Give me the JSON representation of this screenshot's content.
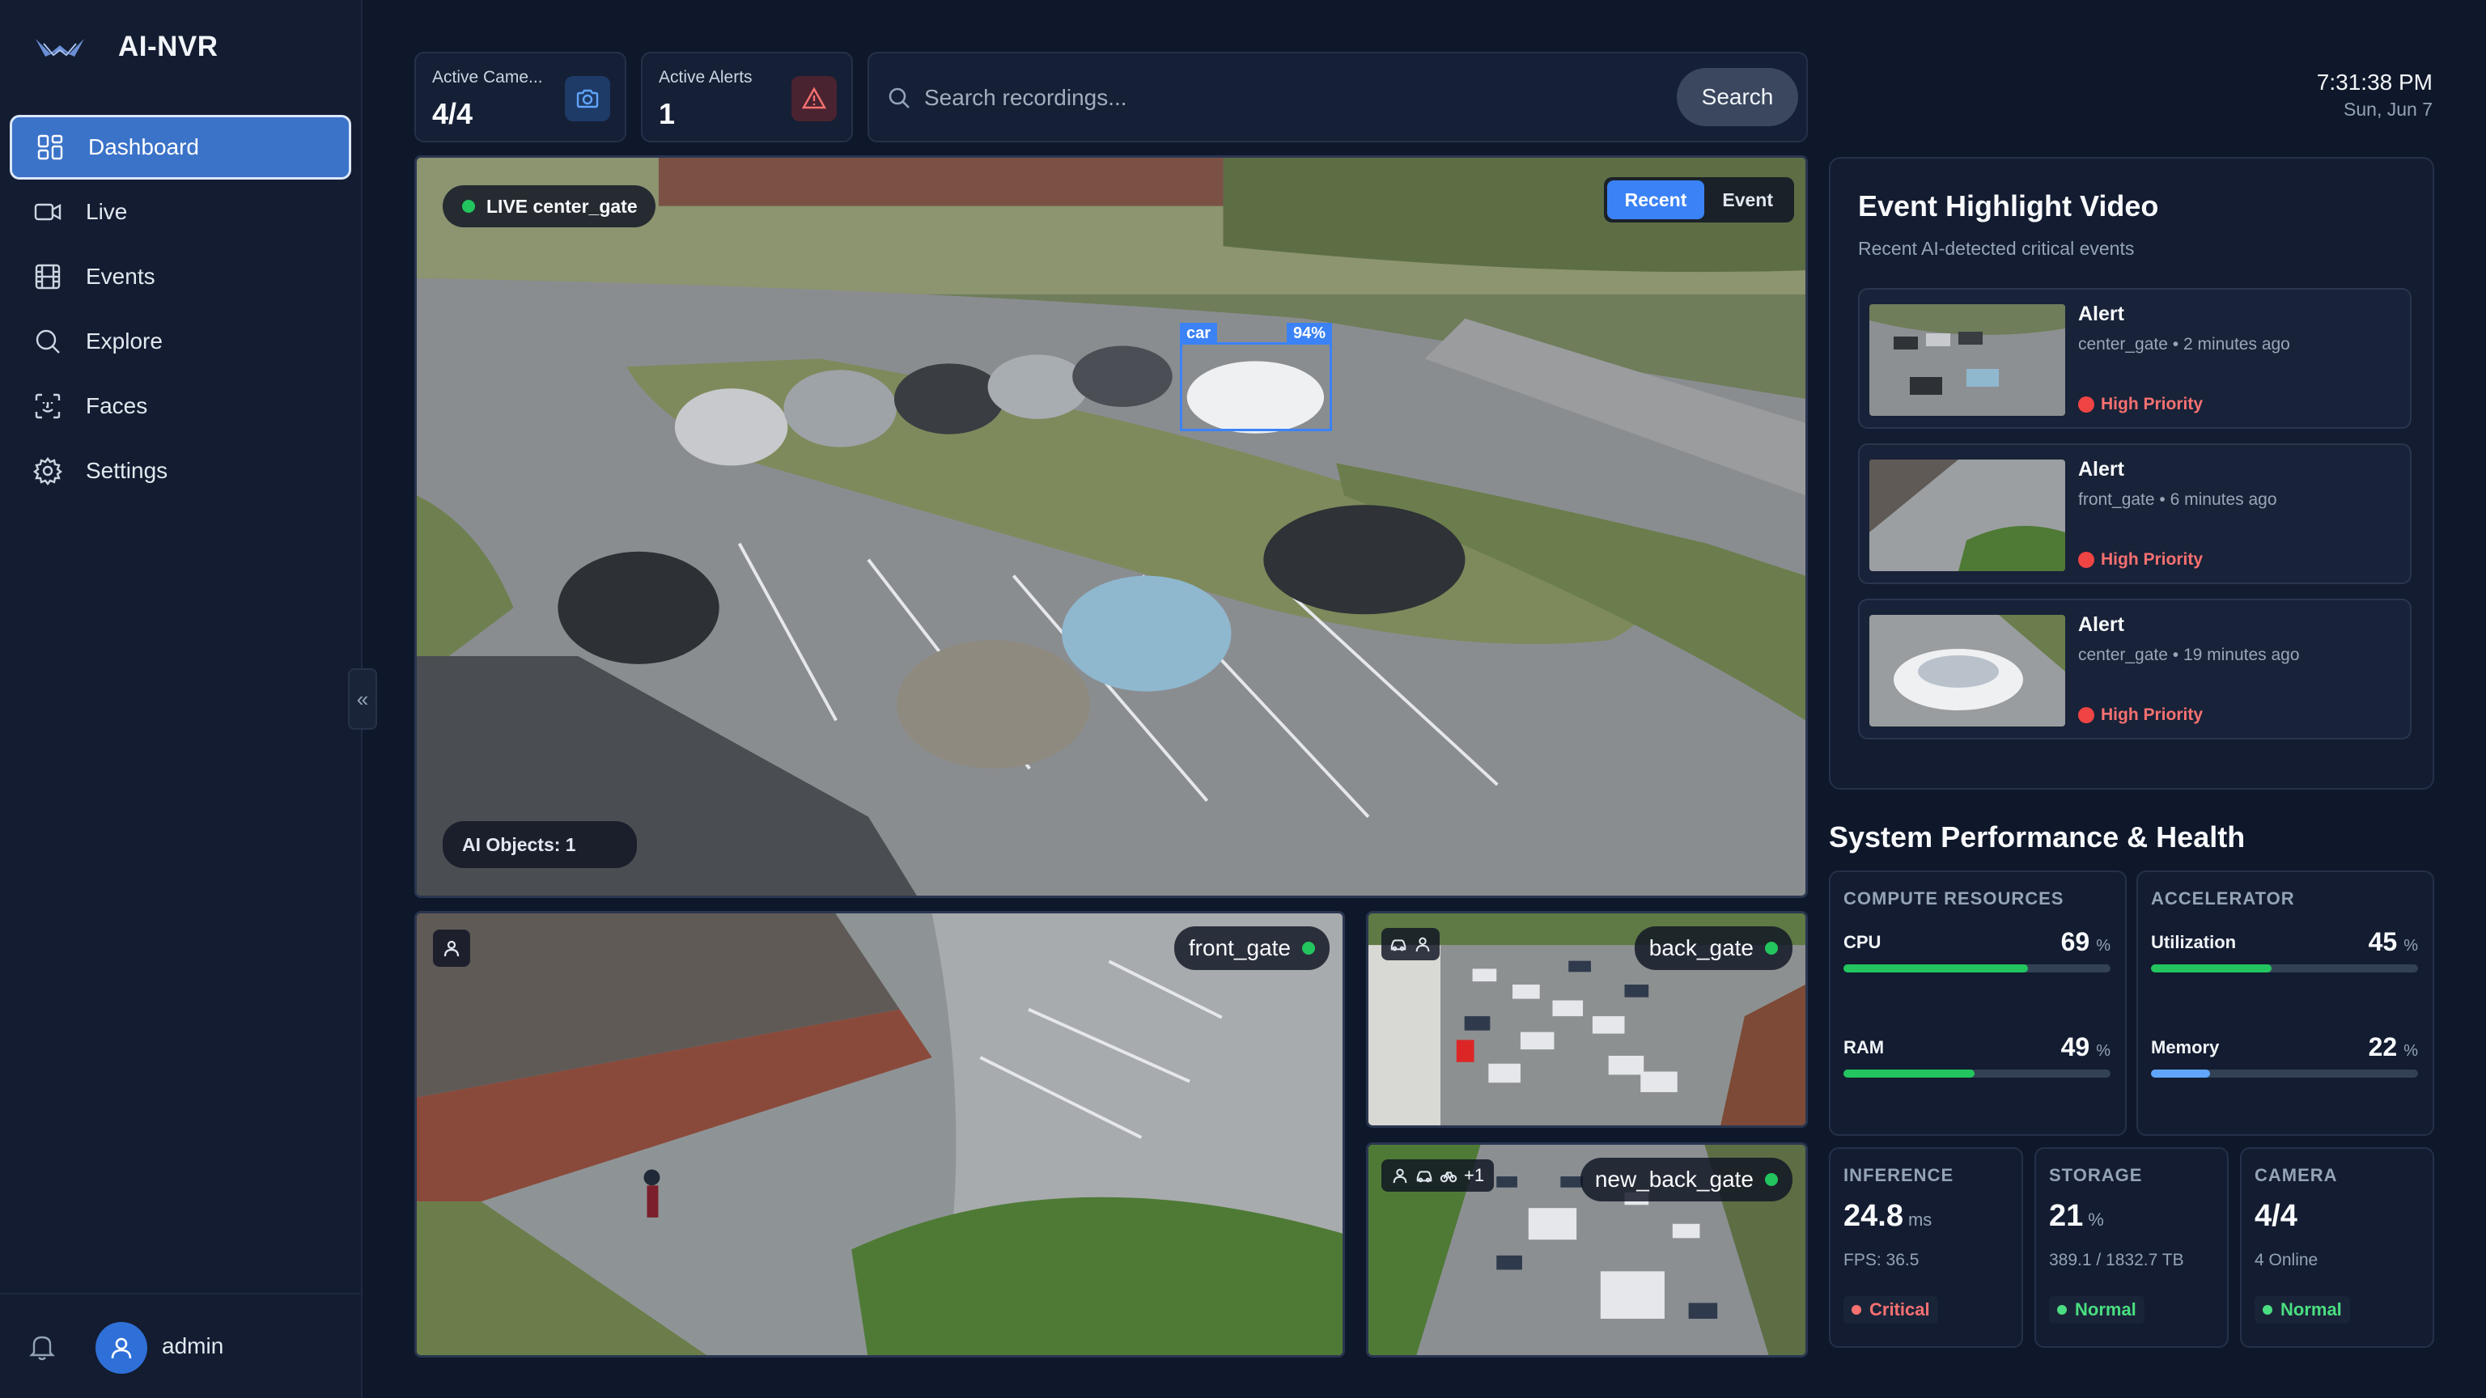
{
  "app": {
    "name": "AI-NVR"
  },
  "sidebar": {
    "items": [
      {
        "label": "Dashboard",
        "icon": "dashboard-icon",
        "active": true
      },
      {
        "label": "Live",
        "icon": "video-icon"
      },
      {
        "label": "Events",
        "icon": "film-icon"
      },
      {
        "label": "Explore",
        "icon": "search-icon"
      },
      {
        "label": "Faces",
        "icon": "face-scan-icon"
      },
      {
        "label": "Settings",
        "icon": "gear-icon"
      }
    ],
    "collapse_glyph": "«",
    "user": "admin"
  },
  "topbar": {
    "active_cameras": {
      "label": "Active Came...",
      "value": "4/4"
    },
    "active_alerts": {
      "label": "Active Alerts",
      "value": "1"
    },
    "search": {
      "placeholder": "Search recordings...",
      "button": "Search"
    },
    "clock": {
      "time": "7:31:38 PM",
      "date": "Sun, Jun 7"
    }
  },
  "main_feed": {
    "live_label": "LIVE center_gate",
    "toggles": [
      "Recent",
      "Event"
    ],
    "active_toggle": "Recent",
    "detection": {
      "label": "car",
      "confidence": "94%"
    },
    "objects": "AI Objects: 1"
  },
  "feeds": [
    {
      "name": "front_gate",
      "extra": ""
    },
    {
      "name": "back_gate",
      "extra": ""
    },
    {
      "name": "new_back_gate",
      "extra": "+1"
    }
  ],
  "event_panel": {
    "title": "Event Highlight Video",
    "subtitle": "Recent AI-detected critical events",
    "events": [
      {
        "type": "Alert",
        "meta": "center_gate • 2 minutes ago",
        "priority": "High Priority"
      },
      {
        "type": "Alert",
        "meta": "front_gate • 6 minutes ago",
        "priority": "High Priority"
      },
      {
        "type": "Alert",
        "meta": "center_gate • 19 minutes ago",
        "priority": "High Priority"
      }
    ]
  },
  "performance": {
    "title": "System Performance & Health",
    "compute": {
      "heading": "COMPUTE RESOURCES",
      "cpu": {
        "label": "CPU",
        "value": "69",
        "unit": "%",
        "level": 0.69,
        "color": "#22c55e"
      },
      "ram": {
        "label": "RAM",
        "value": "49",
        "unit": "%",
        "level": 0.49,
        "color": "#22c55e"
      }
    },
    "accelerator": {
      "heading": "ACCELERATOR",
      "util": {
        "label": "Utilization",
        "value": "45",
        "unit": "%",
        "level": 0.45,
        "color": "#22c55e"
      },
      "memory": {
        "label": "Memory",
        "value": "22",
        "unit": "%",
        "level": 0.22,
        "color": "#60a5fa"
      }
    },
    "inference": {
      "heading": "INFERENCE",
      "value": "24.8",
      "unit": "ms",
      "info": "FPS: 36.5",
      "status": "Critical",
      "status_color": "#f87171"
    },
    "storage": {
      "heading": "STORAGE",
      "value": "21",
      "unit": "%",
      "info": "389.1 / 1832.7 TB",
      "status": "Normal",
      "status_color": "#4ade80"
    },
    "camera": {
      "heading": "CAMERA",
      "value": "4/4",
      "unit": "",
      "info": "4 Online",
      "status": "Normal",
      "status_color": "#4ade80"
    }
  }
}
